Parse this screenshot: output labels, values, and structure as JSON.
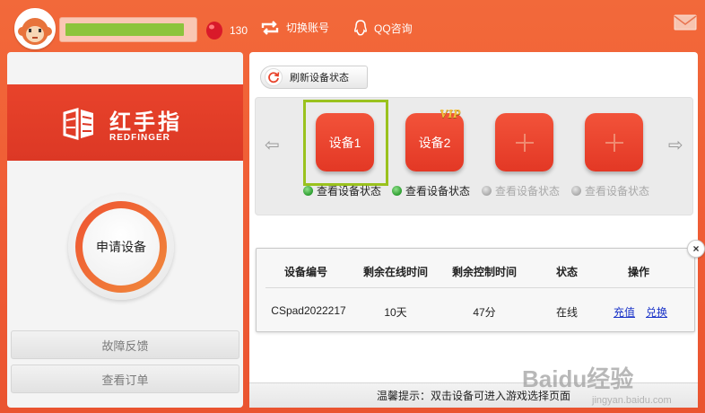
{
  "header": {
    "coin_count": "130",
    "switch_account_label": "切换账号",
    "qq_consult_label": "QQ咨询",
    "icons": {
      "avatar": "monkey-avatar-icon",
      "coin": "red-bean-icon",
      "switch": "switch-arrows-icon",
      "qq": "qq-penguin-icon",
      "mail": "mail-icon"
    }
  },
  "brand": {
    "name_cn": "红手指",
    "name_en": "REDFINGER"
  },
  "left_panel": {
    "apply_device_label": "申请设备",
    "feedback_label": "故障反馈",
    "view_orders_label": "查看订单"
  },
  "toolbar": {
    "refresh_label": "刷新设备状态"
  },
  "devices": [
    {
      "label": "设备1",
      "status_label": "查看设备状态",
      "status": "active",
      "selected": true
    },
    {
      "label": "设备2",
      "badge": "VIP",
      "status_label": "查看设备状态",
      "status": "active"
    },
    {
      "label": "",
      "status_label": "查看设备状态",
      "status": "inactive"
    },
    {
      "label": "",
      "status_label": "查看设备状态",
      "status": "inactive"
    }
  ],
  "table": {
    "headers": [
      "设备编号",
      "剩余在线时间",
      "剩余控制时间",
      "状态",
      "操作"
    ],
    "rows": [
      {
        "device_id": "CSpad2022217",
        "online_time": "10天",
        "control_time": "47分",
        "status": "在线",
        "action_recharge": "充值",
        "action_swap": "兑换"
      }
    ]
  },
  "tip": "温馨提示：双击设备可进入游戏选择页面",
  "watermark": {
    "text": "Baidu经验",
    "sub": "jingyan.baidu.com"
  },
  "colors": {
    "accent": "#ef5b34",
    "device_red": "#e8432b",
    "selected_frame": "#9ac21e",
    "link": "#1a33c8"
  }
}
